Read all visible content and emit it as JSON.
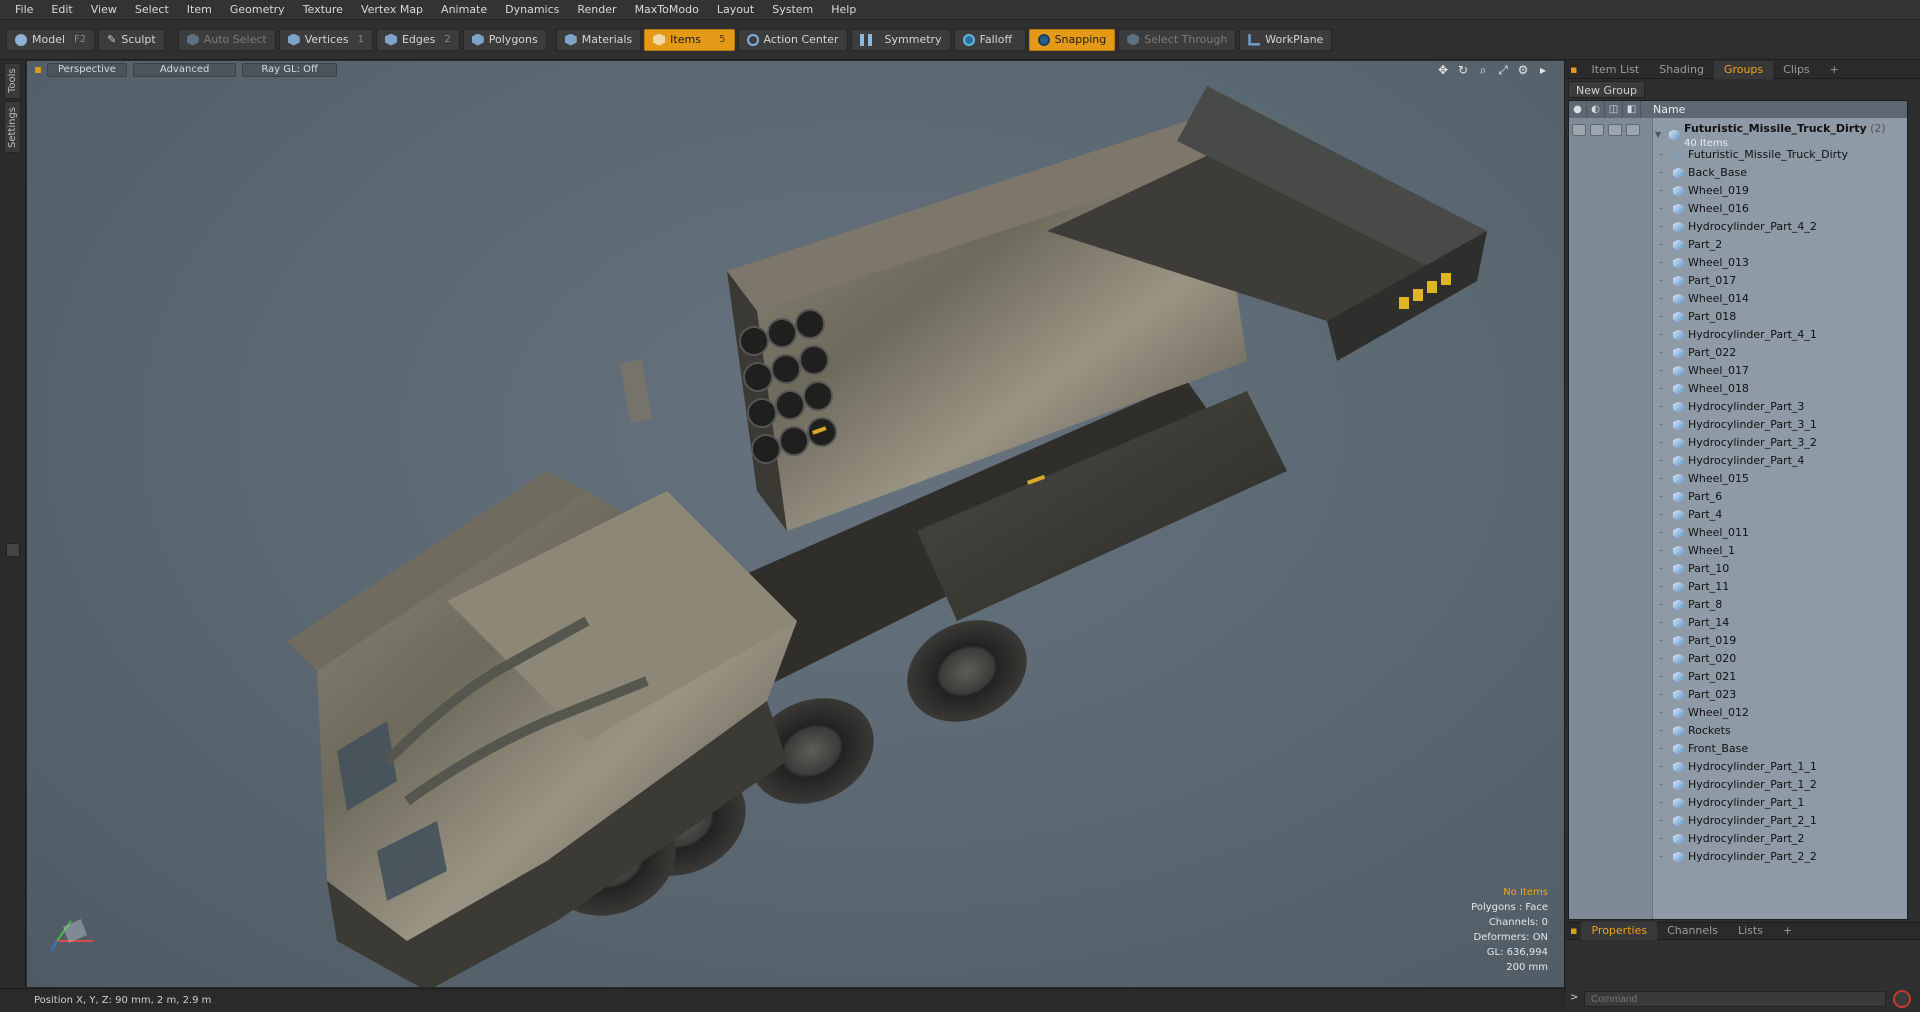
{
  "menu": [
    "File",
    "Edit",
    "View",
    "Select",
    "Item",
    "Geometry",
    "Texture",
    "Vertex Map",
    "Animate",
    "Dynamics",
    "Render",
    "MaxToModo",
    "Layout",
    "System",
    "Help"
  ],
  "toolbar": {
    "model": "Model",
    "model_key": "F2",
    "sculpt": "Sculpt",
    "auto_select": "Auto Select",
    "vertices": "Vertices",
    "vertices_key": "1",
    "edges": "Edges",
    "edges_key": "2",
    "polygons": "Polygons",
    "materials": "Materials",
    "items": "Items",
    "items_key": "5",
    "action_center": "Action Center",
    "symmetry": "Symmetry",
    "falloff": "Falloff",
    "snapping": "Snapping",
    "select_through": "Select Through",
    "workplane": "WorkPlane"
  },
  "left_tabs": {
    "tools": "Tools",
    "settings": "Settings"
  },
  "viewport": {
    "view": "Perspective",
    "shading": "Advanced",
    "raygl": "Ray GL: Off",
    "info": {
      "items": "No Items",
      "polygons": "Polygons : Face",
      "channels": "Channels: 0",
      "deformers": "Deformers: ON",
      "gl": "GL: 636,994",
      "scale": "200 mm"
    }
  },
  "right_panel": {
    "tabs": [
      "Item List",
      "Shading",
      "Groups",
      "Clips",
      "+"
    ],
    "new_group": "New Group",
    "column_name": "Name",
    "root": {
      "name": "Futuristic_Missile_Truck_Dirty",
      "count": "(2)",
      "sub": "40 Items"
    },
    "items": [
      "Futuristic_Missile_Truck_Dirty",
      "Back_Base",
      "Wheel_019",
      "Wheel_016",
      "Hydrocylinder_Part_4_2",
      "Part_2",
      "Wheel_013",
      "Part_017",
      "Wheel_014",
      "Part_018",
      "Hydrocylinder_Part_4_1",
      "Part_022",
      "Wheel_017",
      "Wheel_018",
      "Hydrocylinder_Part_3",
      "Hydrocylinder_Part_3_1",
      "Hydrocylinder_Part_3_2",
      "Hydrocylinder_Part_4",
      "Wheel_015",
      "Part_6",
      "Part_4",
      "Wheel_011",
      "Wheel_1",
      "Part_10",
      "Part_11",
      "Part_8",
      "Part_14",
      "Part_019",
      "Part_020",
      "Part_021",
      "Part_023",
      "Wheel_012",
      "Rockets",
      "Front_Base",
      "Hydrocylinder_Part_1_1",
      "Hydrocylinder_Part_1_2",
      "Hydrocylinder_Part_1",
      "Hydrocylinder_Part_2_1",
      "Hydrocylinder_Part_2",
      "Hydrocylinder_Part_2_2"
    ],
    "bottom_tabs": [
      "Properties",
      "Channels",
      "Lists",
      "+"
    ],
    "command_placeholder": "Command"
  },
  "status": {
    "position": "Position X, Y, Z:  90 mm, 2 m, 2.9 m"
  },
  "colors": {
    "accent": "#e59a17",
    "viewport": "#5a6771"
  }
}
